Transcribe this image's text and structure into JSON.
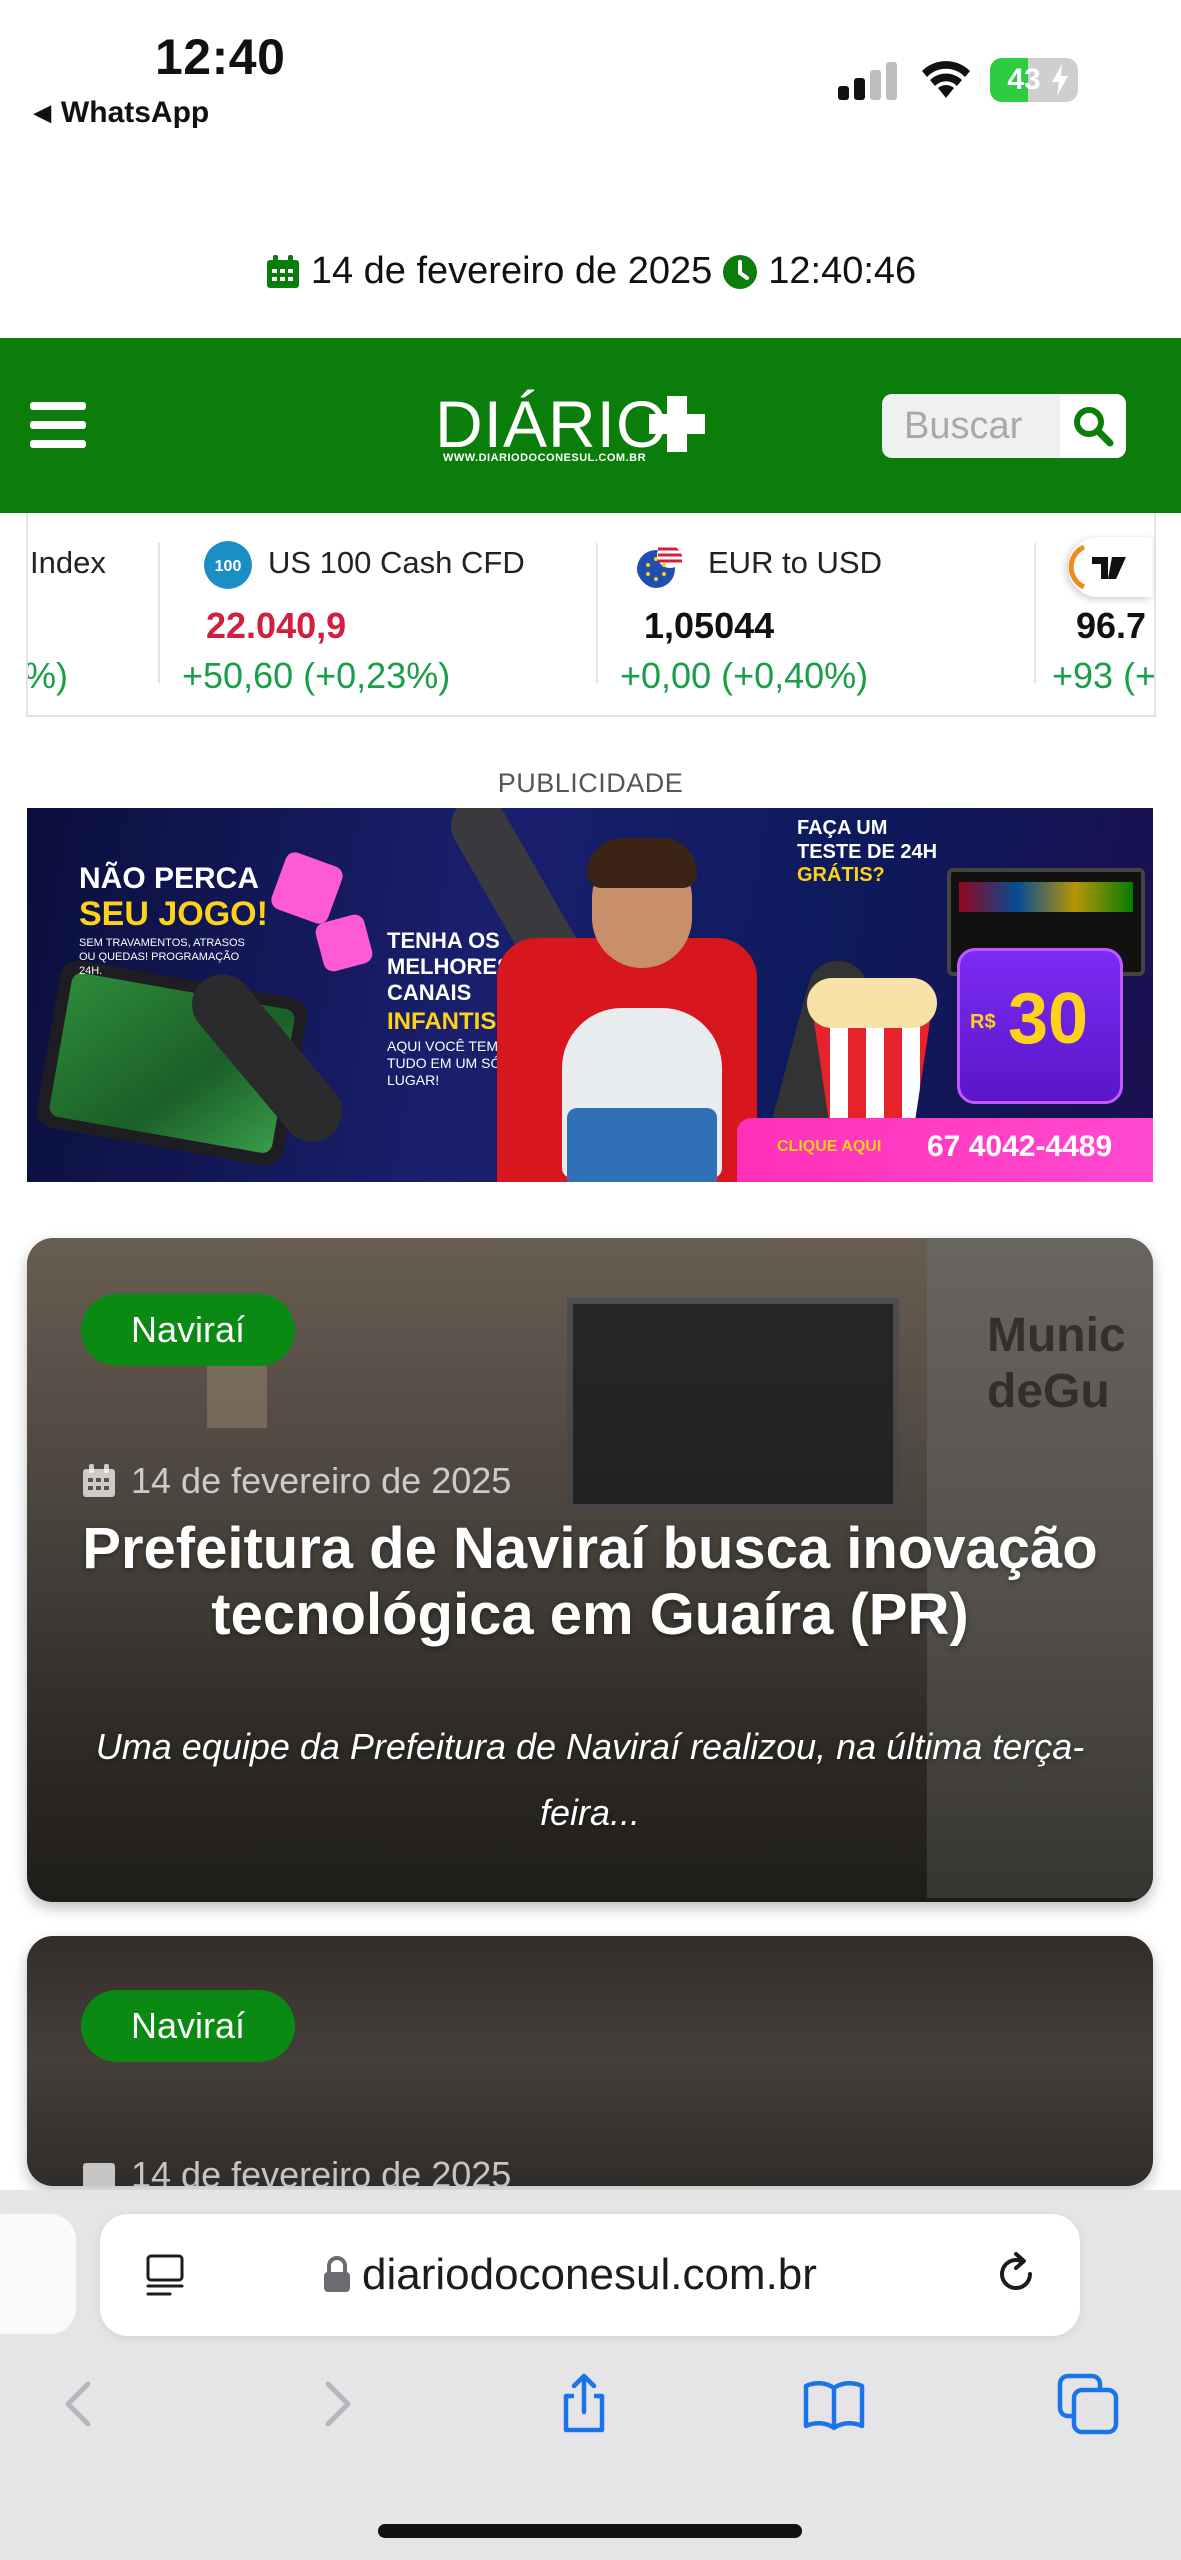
{
  "status_bar": {
    "time": "12:40",
    "back_app": "WhatsApp",
    "battery": "43",
    "battery_level": 0.43
  },
  "date_line": {
    "date": "14 de fevereiro de 2025",
    "time": "12:40:46"
  },
  "header": {
    "logo": "DIÁRIO",
    "logo_sub": "WWW.DIARIODOCONESUL.COM.BR",
    "search_placeholder": "Buscar"
  },
  "ticker": [
    {
      "name": "Index",
      "price": "",
      "change": "%)"
    },
    {
      "badge": "100",
      "name": "US 100 Cash CFD",
      "price": "22.040,9",
      "change": "+50,60 (+0,23%)"
    },
    {
      "name": "EUR to USD",
      "price": "1,05044",
      "change": "+0,00 (+0,40%)"
    },
    {
      "name": "",
      "price": "96.7",
      "change": "+93 (+"
    }
  ],
  "ad": {
    "label": "PUBLICIDADE",
    "line1": "NÃO PERCA",
    "line2": "SEU JOGO!",
    "line3": "SEM TRAVAMENTOS, ATRASOS OU QUEDAS! PROGRAMAÇÃO 24H.",
    "mid1": "TENHA OS MELHORES CANAIS",
    "mid2": "INFANTIS!",
    "mid3": "AQUI VOCÊ TEM TUDO EM UM SÓ LUGAR!",
    "test1": "FAÇA UM TESTE DE 24H",
    "test2": "GRÁTIS?",
    "price_currency": "R$",
    "price": "30",
    "cta": "CLIQUE AQUI",
    "phone": "67 4042-4489"
  },
  "articles": [
    {
      "category": "Naviraí",
      "date": "14 de fevereiro de 2025",
      "title": "Prefeitura de Naviraí busca inovação tecnológica em Guaíra (PR)",
      "excerpt": "Uma equipe da Prefeitura de Naviraí realizou, na última terça-feira..."
    },
    {
      "category": "Naviraí",
      "date": "14 de fevereiro de 2025"
    }
  ],
  "browser": {
    "url": "diariodoconesul.com.br"
  },
  "colors": {
    "brand_green": "#0a7d0a",
    "badge_green": "#0a8a12",
    "ticker_up": "#1a9e4a",
    "ticker_price_red": "#d11f3d"
  }
}
